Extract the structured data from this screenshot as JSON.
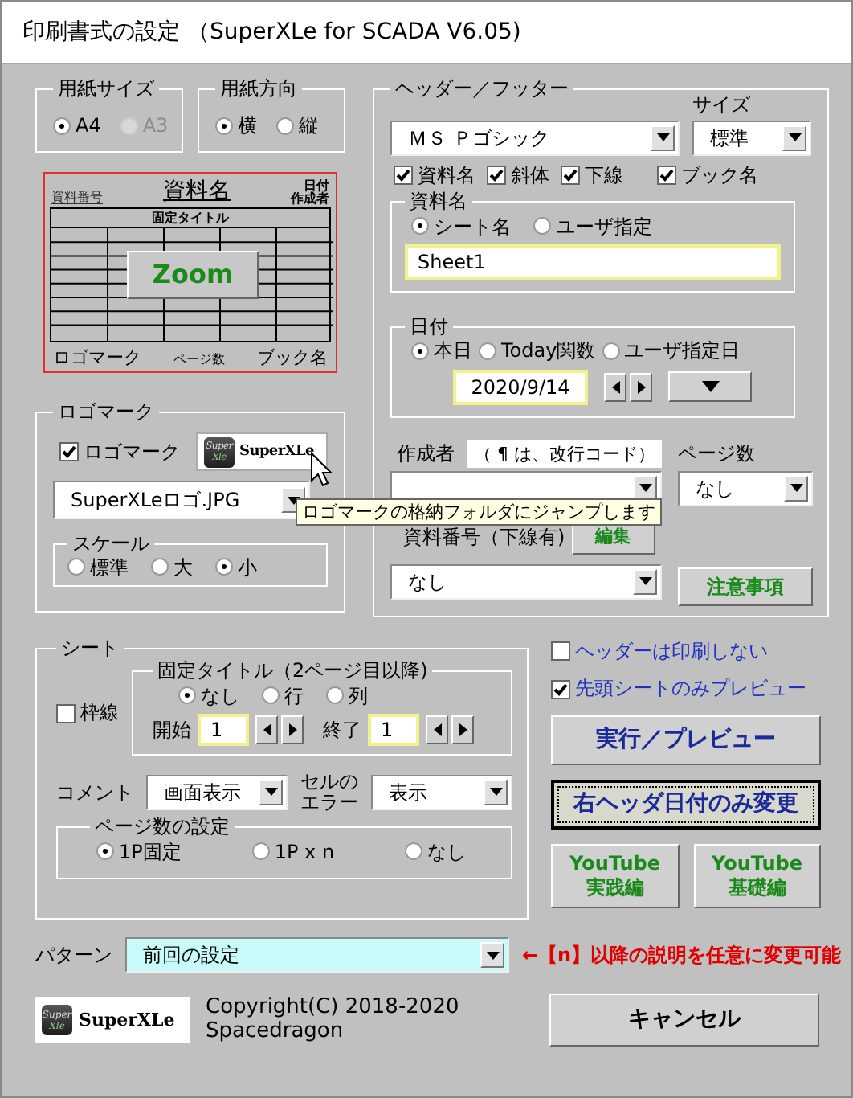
{
  "window": {
    "title": "印刷書式の設定 （SuperXLe for SCADA V6.05)"
  },
  "paper_size": {
    "label": "用紙サイズ",
    "options": [
      {
        "label": "A4",
        "selected": true,
        "disabled": false
      },
      {
        "label": "A3",
        "selected": false,
        "disabled": true
      }
    ]
  },
  "paper_orientation": {
    "label": "用紙方向",
    "options": [
      {
        "label": "横",
        "selected": true
      },
      {
        "label": "縦",
        "selected": false
      }
    ]
  },
  "preview": {
    "doc_number": "資料番号",
    "doc_name": "資料名",
    "date": "日付",
    "author": "作成者",
    "fixed_title": "固定タイトル",
    "zoom_button": "Zoom",
    "logo": "ロゴマーク",
    "page_count": "ページ数",
    "book_name": "ブック名"
  },
  "logo_mark": {
    "label": "ロゴマーク",
    "checkbox": {
      "label": "ロゴマーク",
      "checked": true
    },
    "logo_icon_lines": [
      "Super",
      "Xle"
    ],
    "logo_text": "SuperXLe",
    "file": "SuperXLeロゴ.JPG",
    "scale": {
      "label": "スケール",
      "options": [
        {
          "label": "標準",
          "selected": false
        },
        {
          "label": "大",
          "selected": false
        },
        {
          "label": "小",
          "selected": true
        }
      ]
    }
  },
  "header_footer": {
    "label": "ヘッダー／フッター",
    "font": "ＭＳ Ｐゴシック",
    "size_label": "サイズ",
    "size": "標準",
    "options": [
      {
        "label": "資料名",
        "checked": true
      },
      {
        "label": "斜体",
        "checked": true
      },
      {
        "label": "下線",
        "checked": true
      },
      {
        "label": "ブック名",
        "checked": true
      }
    ],
    "doc_name": {
      "label": "資料名",
      "options": [
        {
          "label": "シート名",
          "selected": true
        },
        {
          "label": "ユーザ指定",
          "selected": false
        }
      ],
      "value": "Sheet1"
    },
    "date": {
      "label": "日付",
      "options": [
        {
          "label": "本日",
          "selected": true
        },
        {
          "label": "Today関数",
          "selected": false
        },
        {
          "label": "ユーザ指定日",
          "selected": false
        }
      ],
      "value": "2020/9/14"
    },
    "author": {
      "label": "作成者",
      "hint": "（ ¶ は、改行コード）"
    },
    "page_count": {
      "label": "ページ数",
      "value": "なし"
    },
    "doc_number": {
      "label": "資料番号（下線有)",
      "edit_button": "編集",
      "value": "なし"
    },
    "notes_button": "注意事項"
  },
  "tooltip": "ロゴマークの格納フォルダにジャンプします",
  "sheet": {
    "label": "シート",
    "gridlines": {
      "label": "枠線",
      "checked": false
    },
    "fixed_title": {
      "label": "固定タイトル（2ページ目以降)",
      "options": [
        {
          "label": "なし",
          "selected": true
        },
        {
          "label": "行",
          "selected": false
        },
        {
          "label": "列",
          "selected": false
        }
      ],
      "start_label": "開始",
      "start": "1",
      "end_label": "終了",
      "end": "1"
    },
    "comment": {
      "label": "コメント",
      "value": "画面表示"
    },
    "cell_error": {
      "label_lines": [
        "セルの",
        "エラー"
      ],
      "value": "表示"
    },
    "page_numbering": {
      "label": "ページ数の設定",
      "options": [
        {
          "label": "1P固定",
          "selected": true
        },
        {
          "label": "1P x n",
          "selected": false
        },
        {
          "label": "なし",
          "selected": false
        }
      ]
    }
  },
  "options": [
    {
      "label": "ヘッダーは印刷しない",
      "checked": false
    },
    {
      "label": "先頭シートのみプレビュー",
      "checked": true
    }
  ],
  "buttons": [
    {
      "label": "実行／プレビュー",
      "kind": "normal"
    },
    {
      "label": "右ヘッダ日付のみ変更",
      "kind": "focused"
    }
  ],
  "youtube_buttons": [
    {
      "lines": [
        "YouTube",
        "実践編"
      ]
    },
    {
      "lines": [
        "YouTube",
        "基礎編"
      ]
    }
  ],
  "pattern": {
    "label": "パターン",
    "value": "前回の設定",
    "note": "←【n】以降の説明を任意に変更可能"
  },
  "footer": {
    "logo_icon_lines": [
      "Super",
      "Xle"
    ],
    "logo_text": "SuperXLe",
    "copyright_lines": [
      "Copyright(C) 2018-2020",
      "Spacedragon"
    ],
    "cancel_button": "キャンセル"
  }
}
